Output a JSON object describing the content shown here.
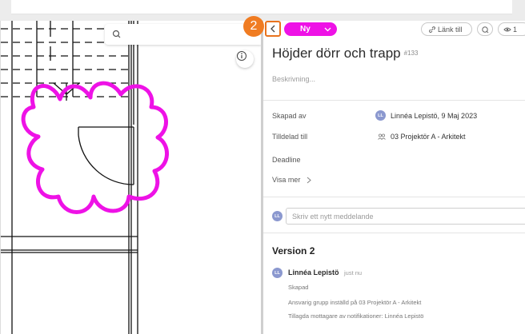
{
  "annotation": {
    "step": "2"
  },
  "viewer": {
    "search": {
      "value": "",
      "placeholder": ""
    },
    "markup_color": "#ee12e6"
  },
  "issue": {
    "status": "Ny",
    "status_color": "#ee12e6",
    "link_button": "Länk till",
    "watchers_count": "1",
    "title": "Höjder dörr och trapp",
    "number": "#133",
    "description_placeholder": "Beskrivning...",
    "fields": {
      "created_by_label": "Skapad av",
      "created_by_initials": "LL",
      "created_by_value": "Linnéa Lepistö, 9 Maj 2023",
      "assigned_label": "Tilldelad till",
      "assigned_value": "03 Projektör A - Arkitekt",
      "deadline_label": "Deadline",
      "show_more": "Visa mer"
    },
    "message": {
      "initials": "LL",
      "placeholder": "Skriv ett nytt meddelande"
    },
    "version": {
      "title": "Version 2",
      "author_initials": "LL",
      "author": "Linnéa Lepistö",
      "time": "just nu",
      "lines": [
        "Skapad",
        "Ansvarig grupp inställd på 03 Projektör A - Arkitekt",
        "Tillagda mottagare av notifikationer: Linnéa Lepistö"
      ]
    }
  },
  "icons": [
    "search-icon",
    "info-icon",
    "chevron-left-icon",
    "chevron-down-icon",
    "link-icon",
    "comment-search-icon",
    "eye-icon",
    "group-icon",
    "chevron-right-icon"
  ]
}
